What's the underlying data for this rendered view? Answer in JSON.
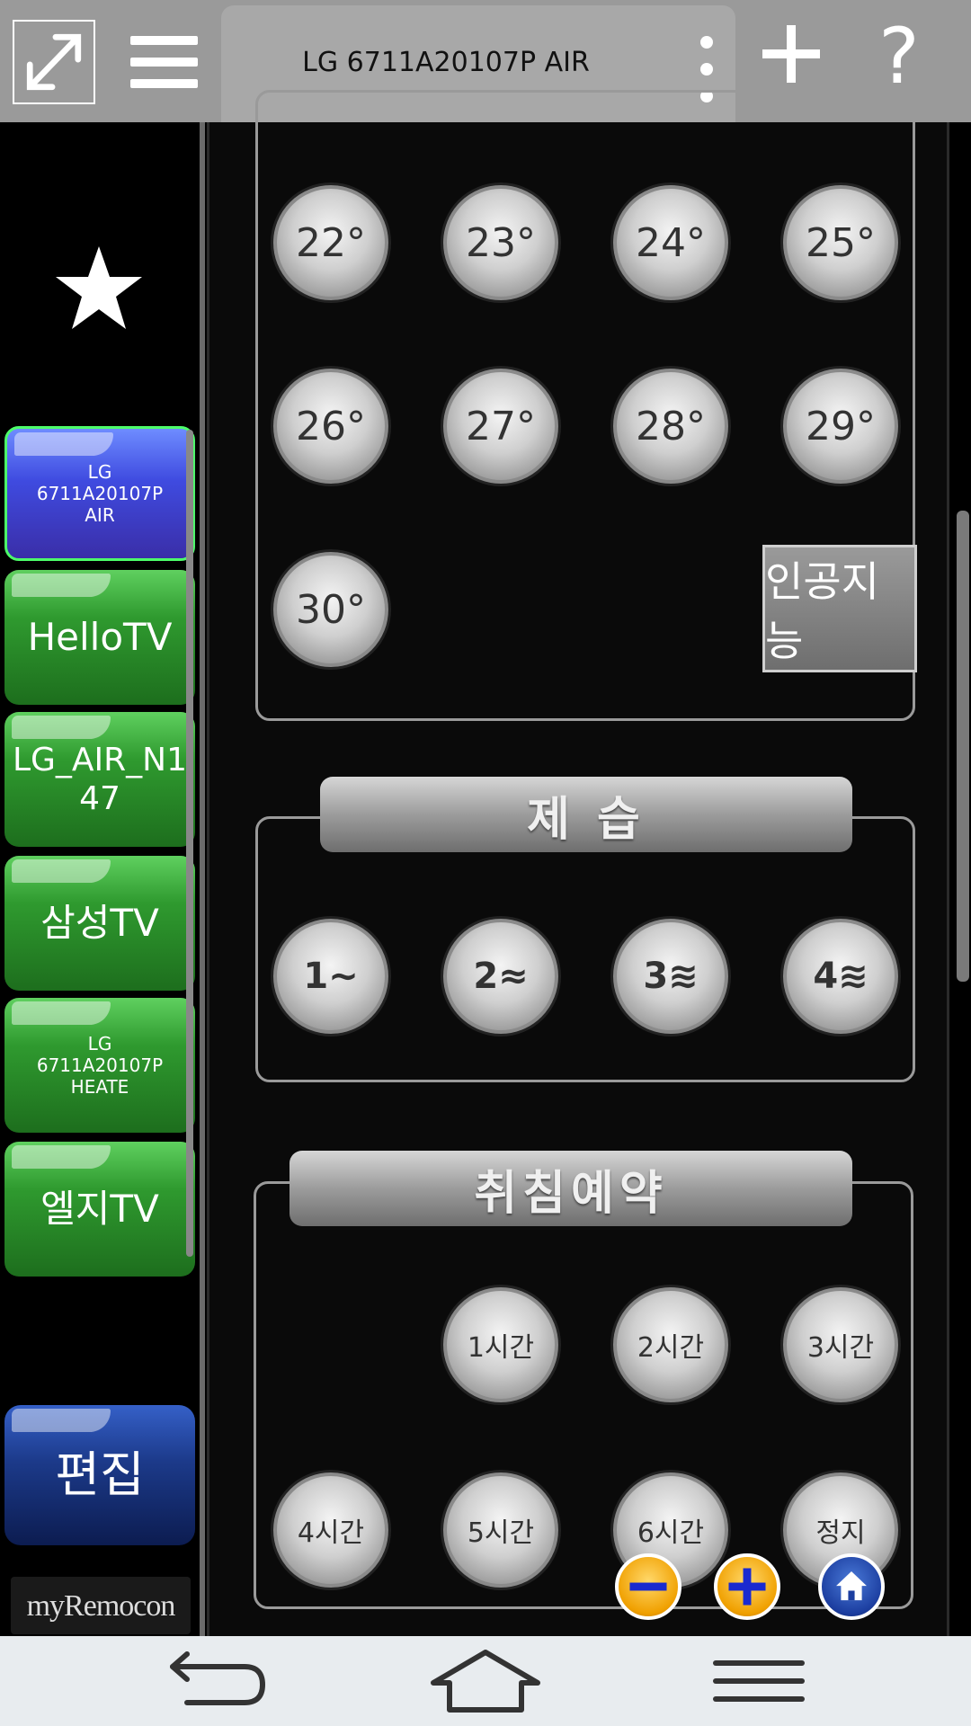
{
  "topbar": {
    "title": "LG 6711A20107P AIR",
    "help_label": "?"
  },
  "sidebar": {
    "devices": [
      {
        "label": "LG 6711A20107P AIR",
        "active": true
      },
      {
        "label": "HelloTV",
        "active": false
      },
      {
        "label": "LG_AIR_N147",
        "active": false
      },
      {
        "label": "삼성TV",
        "active": false
      },
      {
        "label": "LG 6711A20107P HEATE",
        "active": false
      },
      {
        "label": "엘지TV",
        "active": false
      }
    ],
    "edit_label": "편집",
    "logo_text": "myRemocon"
  },
  "temperature": {
    "buttons": [
      "22°",
      "23°",
      "24°",
      "25°",
      "26°",
      "27°",
      "28°",
      "29°",
      "30°"
    ],
    "ai_label": "인공지능"
  },
  "dehumidify": {
    "title": "제 습",
    "buttons": [
      "1∼",
      "2≈",
      "3≋",
      "4≋"
    ]
  },
  "sleep_timer": {
    "title": "취침예약",
    "buttons": [
      "1시간",
      "2시간",
      "3시간",
      "4시간",
      "5시간",
      "6시간",
      "정지"
    ]
  },
  "colors": {
    "topbar": "#9a9a9a",
    "active_device": "#3f4be0",
    "device": "#2f9a2f",
    "navbar": "#e8ecef"
  }
}
